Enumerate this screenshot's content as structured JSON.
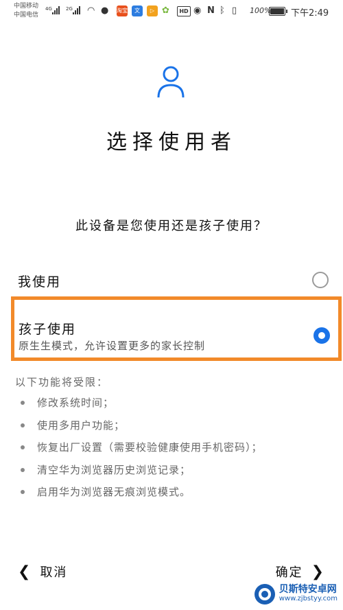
{
  "status_bar": {
    "carrier1": "中国移动",
    "carrier2": "中国电信",
    "net1": "4G",
    "net2": "2G",
    "app_icon_label": "淘宝",
    "battery_percent": "100%",
    "battery_level": 1.0,
    "time": "下午2:49"
  },
  "page": {
    "title": "选择使用者",
    "question": "此设备是您使用还是孩子使用？"
  },
  "options": [
    {
      "label": "我使用",
      "selected": false
    },
    {
      "label": "孩子使用",
      "description": "原生生模式，允许设置更多的家长控制",
      "selected": true
    }
  ],
  "restrictions": {
    "title": "以下功能将受限：",
    "items": [
      "修改系统时间；",
      "使用多用户功能；",
      "恢复出厂设置（需要校验健康使用手机密码）；",
      "清空华为浏览器历史浏览记录；",
      "启用华为浏览器无痕浏览模式。"
    ]
  },
  "nav": {
    "cancel_label": "取消",
    "confirm_label": "确定"
  },
  "watermark": {
    "name": "贝斯特安卓网",
    "url": "www.zjbstyy.com"
  },
  "colors": {
    "accent": "#1a73e8",
    "highlight_border": "#f28a2a"
  }
}
